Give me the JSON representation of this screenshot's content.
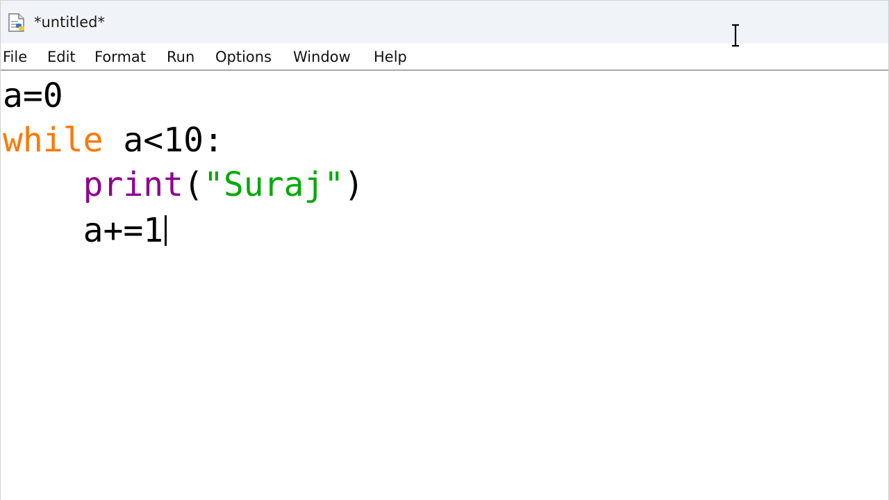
{
  "window": {
    "title": "*untitled*"
  },
  "menu": {
    "items": [
      "File",
      "Edit",
      "Format",
      "Run",
      "Options",
      "Window",
      "Help"
    ]
  },
  "editor": {
    "line1": "a=0",
    "line2": {
      "keyword": "while",
      "rest": " a<10:"
    },
    "line3": {
      "indent": "    ",
      "builtin": "print",
      "open": "(",
      "string": "\"Suraj\"",
      "close": ")"
    },
    "line4": {
      "indent": "    ",
      "text": "a+=1"
    }
  },
  "colors": {
    "keyword": "#ff7700",
    "builtin": "#900090",
    "string": "#00aa00"
  },
  "icons": {
    "app": "python-file-icon",
    "cursor": "text-cursor-icon"
  }
}
